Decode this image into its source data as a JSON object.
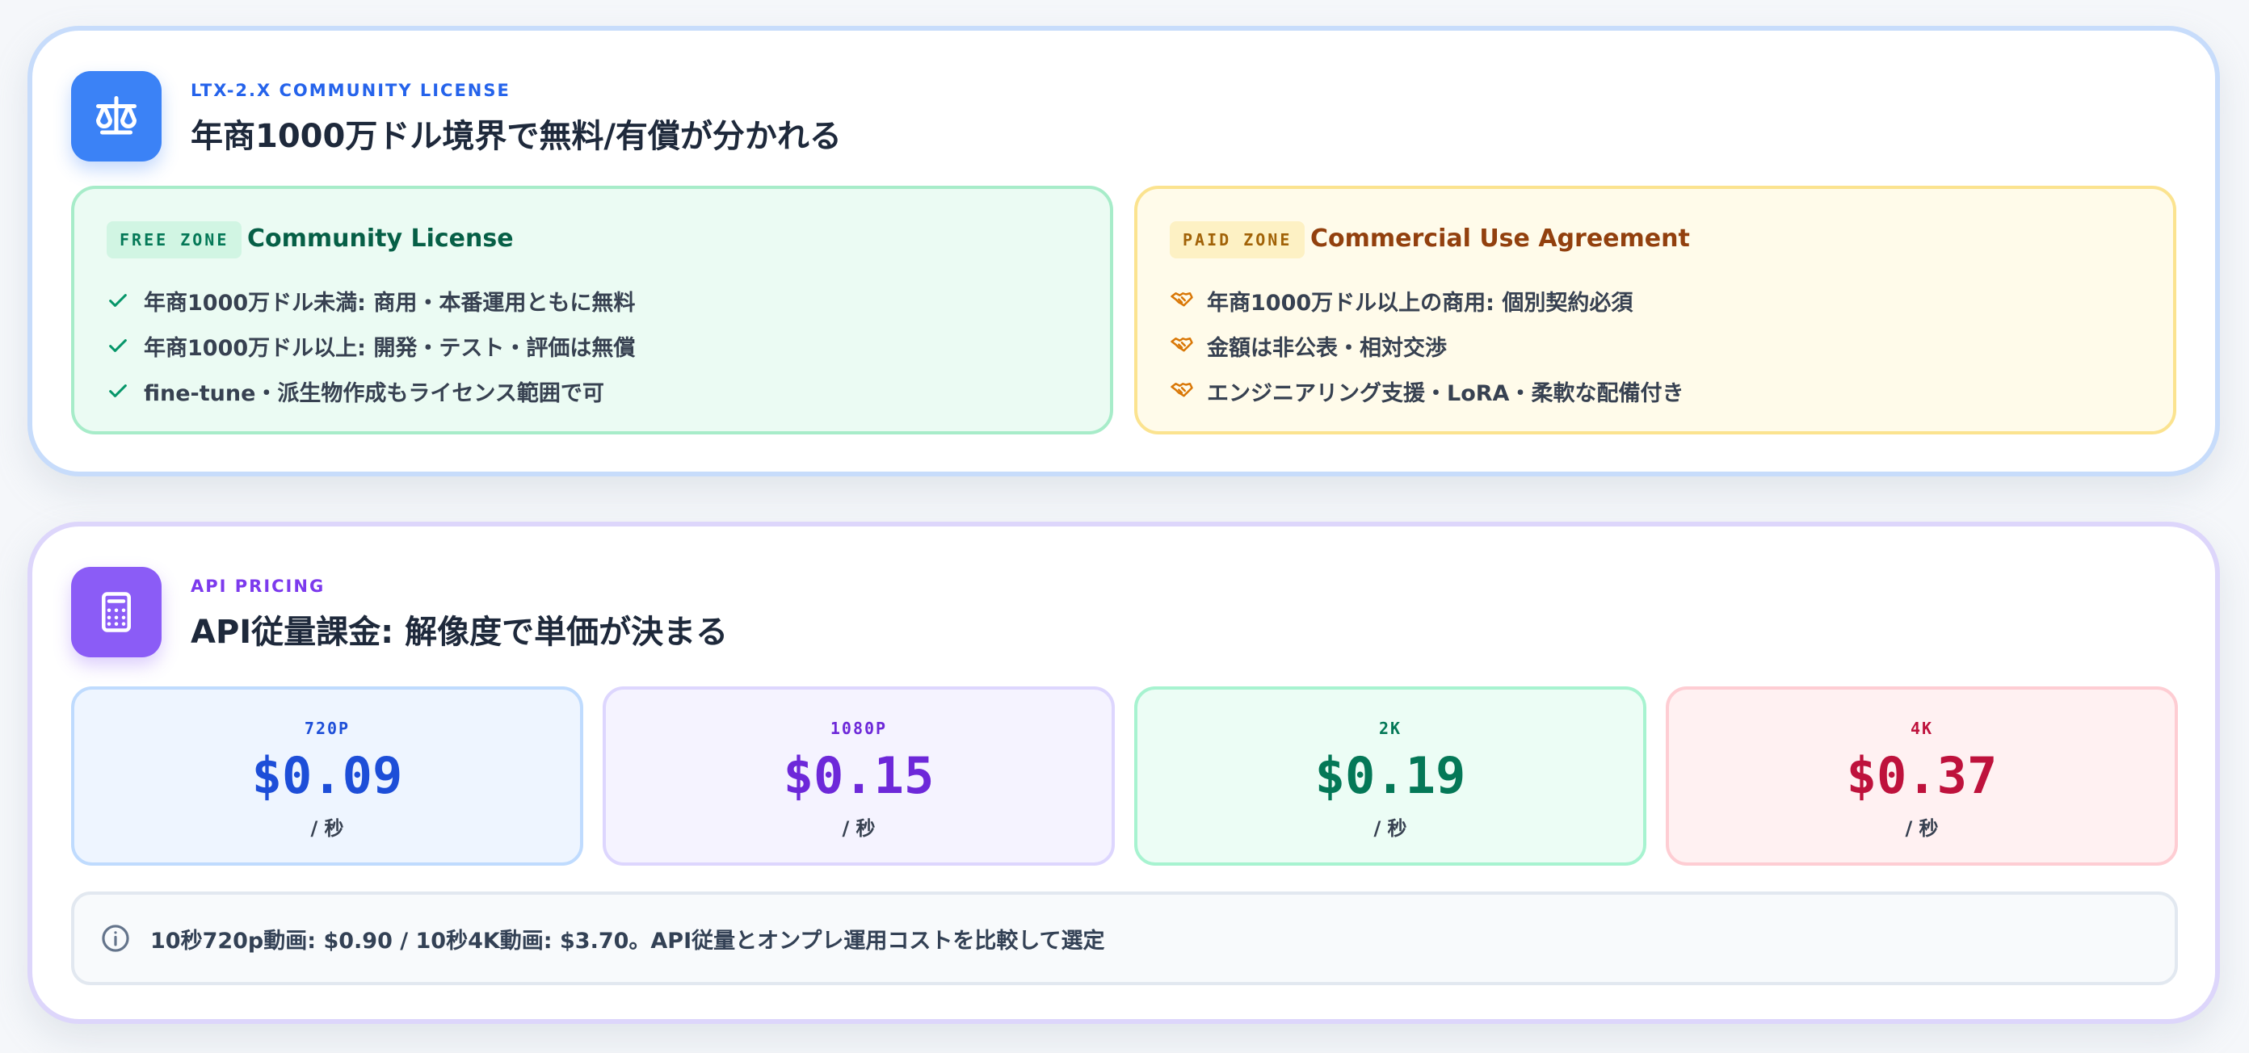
{
  "license": {
    "eyebrow": "LTX-2.X COMMUNITY LICENSE",
    "title": "年商1000万ドル境界で無料/有償が分かれる",
    "icon": "scale-icon",
    "free": {
      "badge": "FREE ZONE",
      "title": "Community License",
      "icon": "check-icon",
      "items": [
        "年商1000万ドル未満: 商用・本番運用ともに無料",
        "年商1000万ドル以上: 開発・テスト・評価は無償",
        "fine-tune・派生物作成もライセンス範囲で可"
      ]
    },
    "paid": {
      "badge": "PAID ZONE",
      "title": "Commercial Use Agreement",
      "icon": "handshake-icon",
      "items": [
        "年商1000万ドル以上の商用: 個別契約必須",
        "金額は非公表・相対交渉",
        "エンジニアリング支援・LoRA・柔軟な配備付き"
      ]
    }
  },
  "api": {
    "eyebrow": "API PRICING",
    "title": "API従量課金: 解像度で単価が決まる",
    "icon": "calculator-icon",
    "tiers": [
      {
        "res": "720P",
        "price": "$0.09",
        "unit": "/ 秒"
      },
      {
        "res": "1080P",
        "price": "$0.15",
        "unit": "/ 秒"
      },
      {
        "res": "2K",
        "price": "$0.19",
        "unit": "/ 秒"
      },
      {
        "res": "4K",
        "price": "$0.37",
        "unit": "/ 秒"
      }
    ],
    "note": "10秒720p動画: $0.90 / 10秒4K動画: $3.70。API従量とオンプレ運用コストを比較して選定",
    "note_icon": "info-icon"
  },
  "colors": {
    "blue_accent": "#3b82f6",
    "purple_accent": "#8b5cf6",
    "free_green": "#047857",
    "paid_amber": "#a16207",
    "tier_720": "#1d4ed8",
    "tier_1080": "#6d28d9",
    "tier_2k": "#047857",
    "tier_4k": "#be123c"
  }
}
